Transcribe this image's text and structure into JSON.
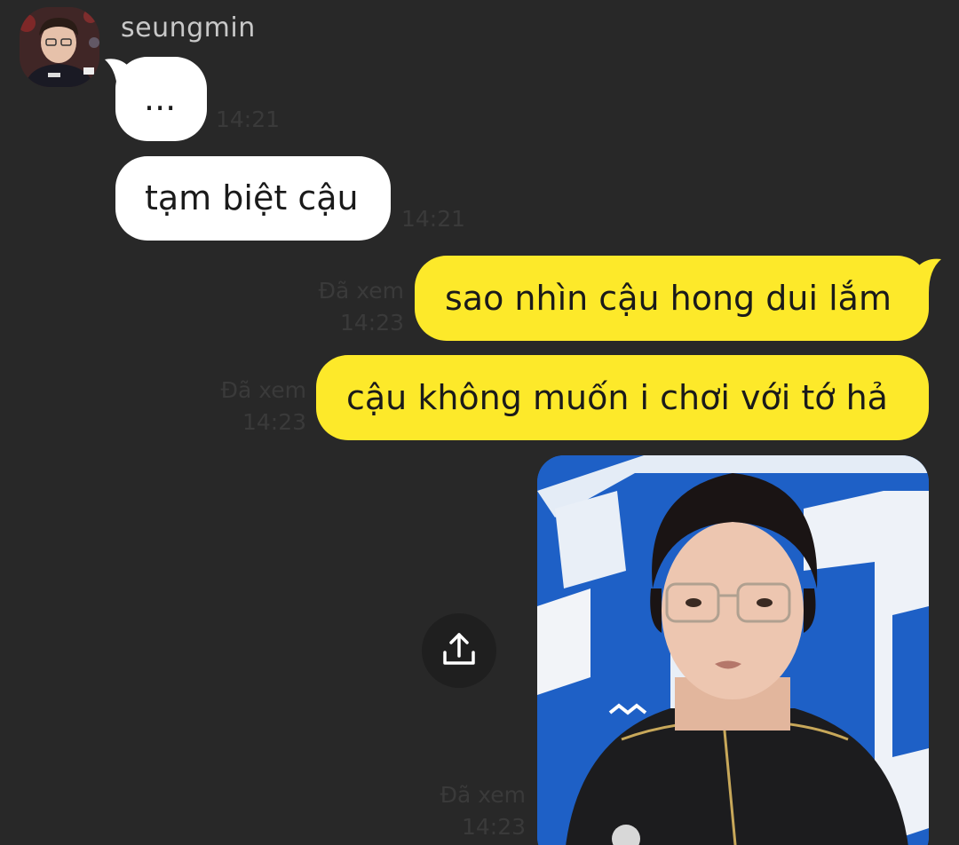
{
  "chat": {
    "sender_name": "seungmin",
    "messages": [
      {
        "from": "them",
        "text": "...",
        "time": "14:21"
      },
      {
        "from": "them",
        "text": "tạm biệt cậu",
        "time": "14:21"
      },
      {
        "from": "me",
        "text": "sao nhìn cậu hong dui lắm",
        "status": "Đã xem",
        "time": "14:23"
      },
      {
        "from": "me",
        "text": "cậu không muốn i chơi với tớ hả",
        "status": "Đã xem",
        "time": "14:23"
      },
      {
        "from": "me",
        "type": "photo",
        "status": "Đã xem",
        "time": "14:23"
      }
    ]
  },
  "icons": {
    "avatar": "profile-photo",
    "share": "share-upload-icon"
  },
  "colors": {
    "background": "#282828",
    "incoming_bubble": "#ffffff",
    "outgoing_bubble": "#fde92a",
    "meta_text": "#3a3a3a"
  }
}
